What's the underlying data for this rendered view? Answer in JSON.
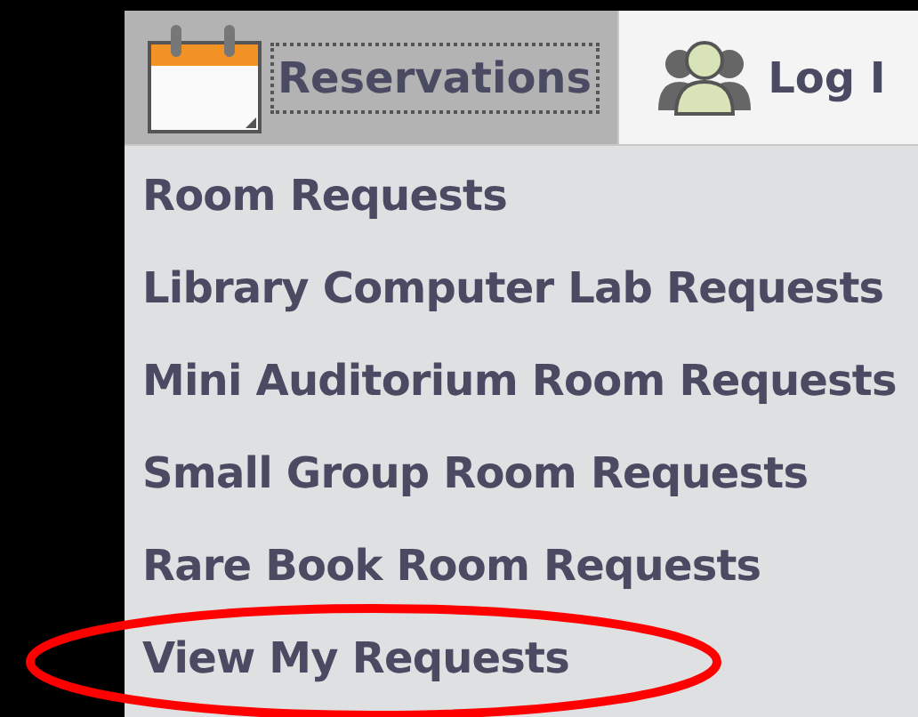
{
  "nav_tabs": [
    {
      "label": "Reservations",
      "selected": true
    },
    {
      "label": "Log I",
      "selected": false
    }
  ],
  "menu_items": [
    {
      "label": "Room Requests",
      "circled": false
    },
    {
      "label": "Library Computer Lab Requests",
      "circled": false
    },
    {
      "label": "Mini Auditorium Room Requests",
      "circled": false
    },
    {
      "label": "Small Group Room Requests",
      "circled": false
    },
    {
      "label": "Rare Book Room Requests",
      "circled": false
    },
    {
      "label": "View My Requests",
      "circled": true
    }
  ]
}
